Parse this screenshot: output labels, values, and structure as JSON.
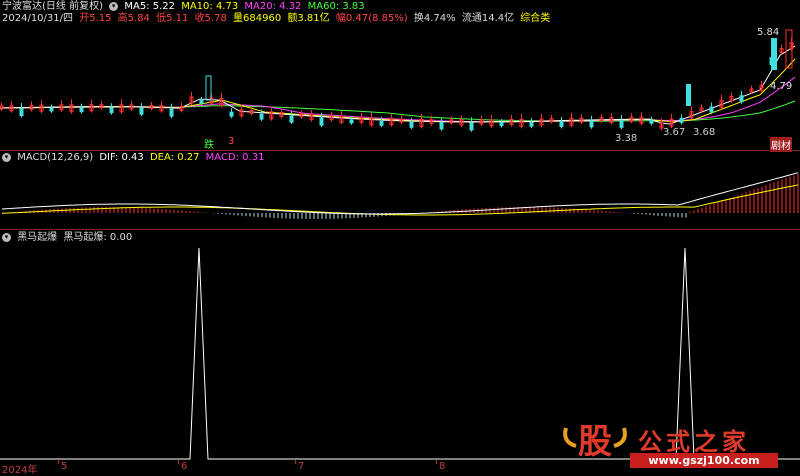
{
  "main_header": {
    "title": "宁波富达(日线 前复权)",
    "ma5": "MA5: 5.22",
    "ma10": "MA10: 4.73",
    "ma20": "MA20: 4.32",
    "ma60": "MA60: 3.83",
    "colors": {
      "ma5": "#ffffff",
      "ma10": "#ffff00",
      "ma20": "#ff40ff",
      "ma60": "#40ff40"
    }
  },
  "quote_line": {
    "date": "2024/10/31/四",
    "open": "开5.15",
    "high": "高5.84",
    "low": "低5.11",
    "close": "收5.78",
    "volume": "量684960",
    "amount": "额3.81亿",
    "change": "幅0.47(8.85%)",
    "turnover": "换4.74%",
    "float": "流通14.4亿",
    "sector": "综合类"
  },
  "price_labels": {
    "high": "5.84",
    "level": "4.79",
    "low_a": "3.38",
    "low_b": "3.67",
    "low_c": "3.68"
  },
  "markers": {
    "die": "跌",
    "short": "3",
    "right_tag": "剧材"
  },
  "macd_header": {
    "name": "MACD(12,26,9)",
    "dif": "DIF: 0.43",
    "dea": "DEA: 0.27",
    "macd": "MACD: 0.31",
    "colors": {
      "dif": "#ffffff",
      "dea": "#ffff00",
      "macd": "#ff40ff"
    }
  },
  "indicator_header": {
    "name": "黑马起爆",
    "series": "黑马起爆: 0.00"
  },
  "x_axis": {
    "labels": [
      "2024年",
      "5",
      "6",
      "7",
      "8"
    ]
  },
  "logo": {
    "glyph": "股",
    "name": "公式之家",
    "url": "www.gszj100.com"
  }
}
